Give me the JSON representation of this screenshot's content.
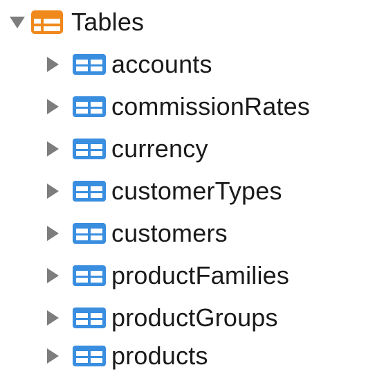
{
  "tree": {
    "root": {
      "label": "Tables",
      "expanded": true,
      "icon": "table-group-icon",
      "icon_color": "#f0891c"
    },
    "table_icon": "table-icon",
    "table_icon_color": "#3a8ee0",
    "disclosure_color": "#7d7d7d",
    "items": [
      {
        "label": "accounts",
        "expanded": false
      },
      {
        "label": "commissionRates",
        "expanded": false
      },
      {
        "label": "currency",
        "expanded": false
      },
      {
        "label": "customerTypes",
        "expanded": false
      },
      {
        "label": "customers",
        "expanded": false
      },
      {
        "label": "productFamilies",
        "expanded": false
      },
      {
        "label": "productGroups",
        "expanded": false
      },
      {
        "label": "products",
        "expanded": false
      }
    ]
  }
}
